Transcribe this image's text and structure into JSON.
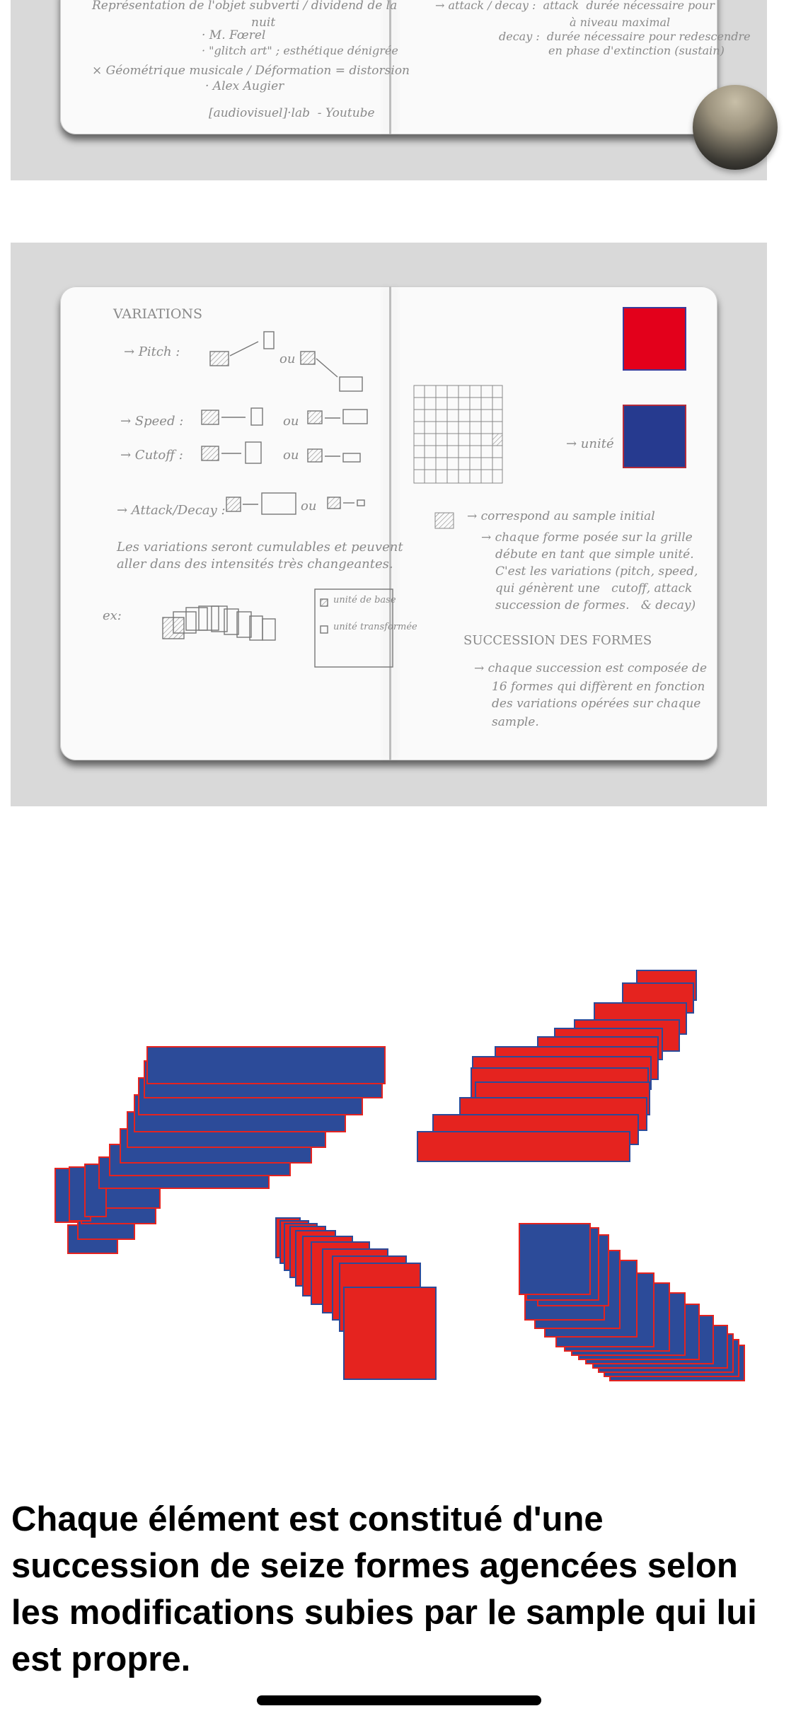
{
  "notebook_top": {
    "left_lines": [
      "Représentation de l'objet subverti / dividend de la",
      "nuit",
      "· M. Fœrel",
      "· \"glitch art\" ; esthétique dénigrée",
      "× Géométrique musicale / Déformation = distorsion",
      "· Alex Augier",
      "[audiovisuel]·lab  - Youtube"
    ],
    "right_lines": [
      "→ attack / decay :  attack  durée nécessaire pour",
      "à niveau maximal",
      "decay :  durée nécessaire pour redescendre",
      "en phase d'extinction (sustain)"
    ]
  },
  "notebook_sketch": {
    "heading": "VARIATIONS",
    "rows": [
      {
        "label": "→ Pitch :",
        "or": "ou"
      },
      {
        "label": "→ Speed :",
        "or": "ou"
      },
      {
        "label": "→ Cutoff :",
        "or": "ou"
      },
      {
        "label": "→ Attack/Decay :",
        "or": "ou"
      }
    ],
    "note_lines": [
      "Les variations seront cumulables et peuvent",
      "aller dans des intensités très changeantes."
    ],
    "ex_label": "ex:",
    "legend": [
      "unité de base",
      "unité transformée"
    ],
    "grid_label": "→ unité",
    "right_lines": [
      "→ correspond au sample initial",
      "→ chaque forme posée sur la grille",
      "débute en tant que simple unité.",
      "C'est les variations (pitch, speed,",
      "qui génèrent une   cutoff, attack",
      "succession de formes.   & decay)"
    ],
    "succession_heading": "SUCCESSION DES FORMES",
    "succession_lines": [
      "→ chaque succession est composée de",
      "16 formes qui diffèrent en fonction",
      "des variations opérées sur chaque",
      "sample."
    ],
    "swatches": {
      "red": "#e3001b",
      "blue": "#263a8f"
    }
  },
  "colors": {
    "red": "#e5231f",
    "blue": "#2c4b99",
    "panel_bg": "#d9d9d9"
  },
  "caption": "Chaque élément est constitué d'une succession de seize formes agencées selon les modifications subies par le sample qui lui est propre."
}
